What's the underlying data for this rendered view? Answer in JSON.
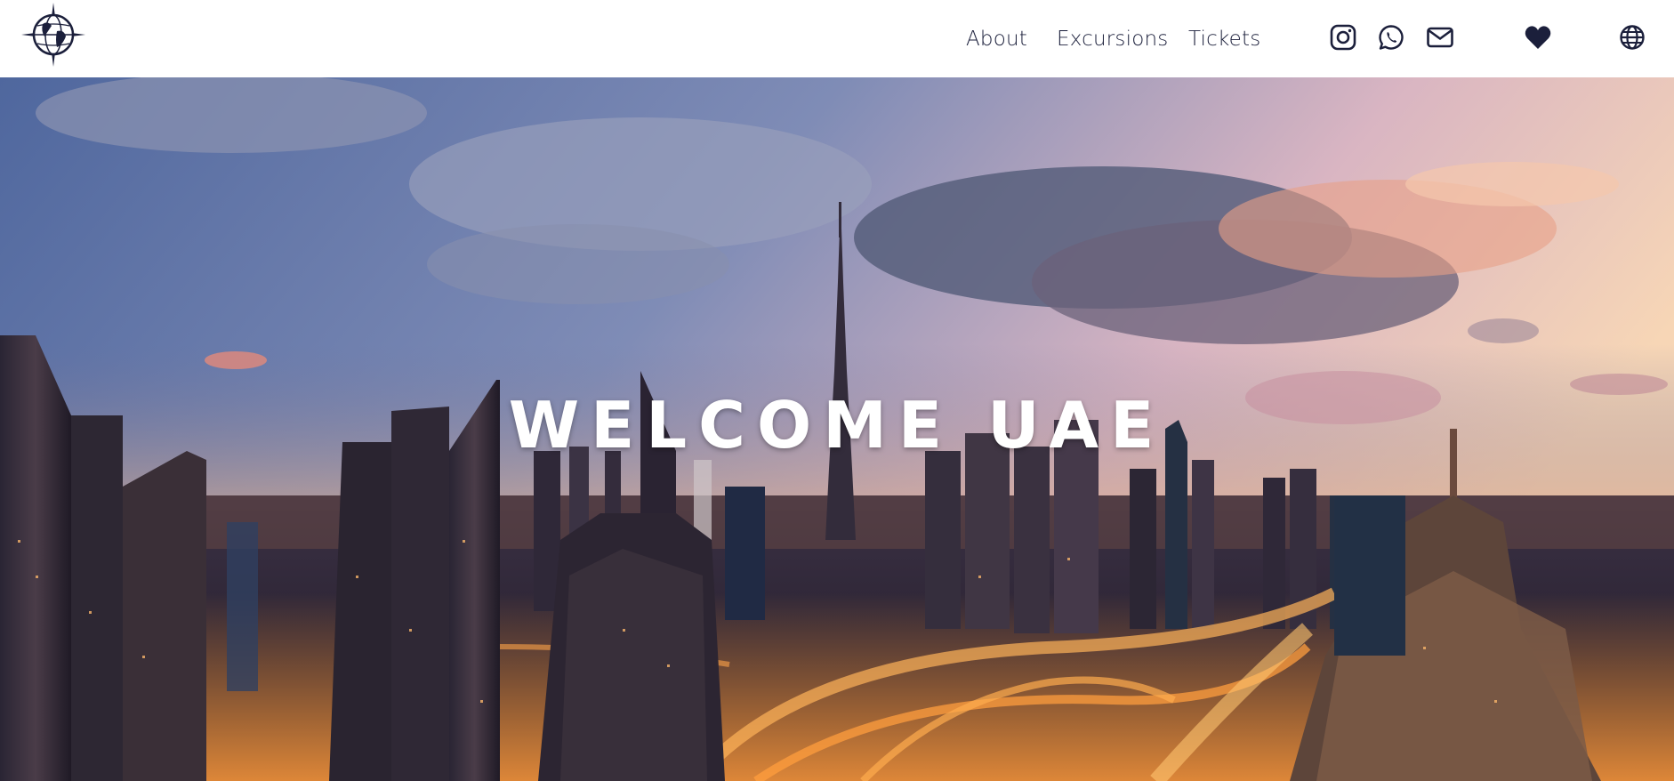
{
  "header": {
    "logo_icon": "globe-compass-icon",
    "nav": {
      "about": "About",
      "excursions": "Excursions",
      "tickets": "Tickets"
    },
    "social_icons": [
      "instagram-icon",
      "whatsapp-icon",
      "mail-icon"
    ],
    "favorites_icon": "heart-icon",
    "language_icon": "globe-icon",
    "text_color": "#1b1f3b"
  },
  "hero": {
    "title": "WELCOME UAE",
    "title_color": "#ffffff"
  }
}
